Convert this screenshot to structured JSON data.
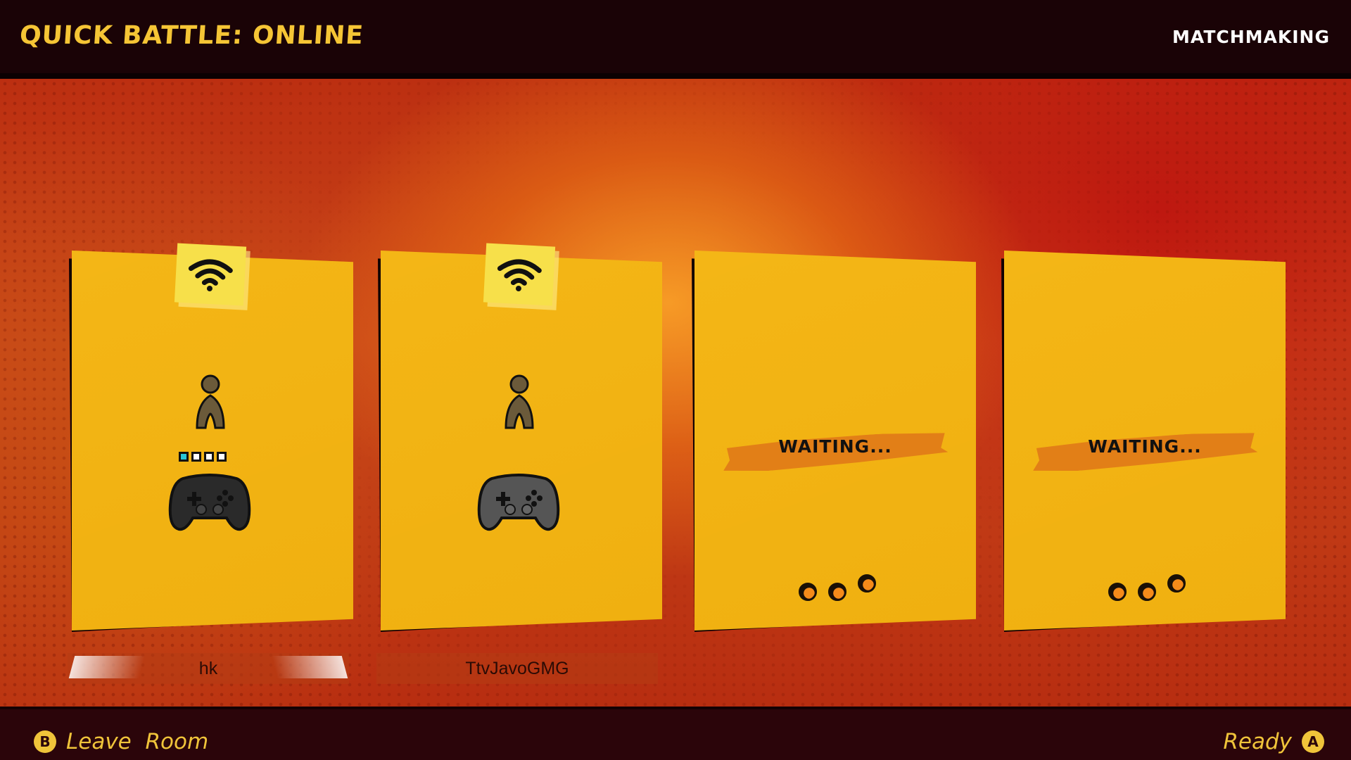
{
  "header": {
    "title": "QUICK BATTLE: ONLINE",
    "mode": "MATCHMAKING"
  },
  "slots": [
    {
      "state": "connected",
      "connection_icon": "wifi-icon",
      "player_icon": "player-icon",
      "controller_icon": "gamepad-icon",
      "player_name": "hk",
      "active_port": 1,
      "ports": 4
    },
    {
      "state": "connected",
      "connection_icon": "wifi-icon",
      "player_icon": "player-icon",
      "controller_icon": "gamepad-icon",
      "player_name": "TtvJavoGMG"
    },
    {
      "state": "waiting",
      "status_text": "WAITING...",
      "loading_icon": "loading-dots-icon"
    },
    {
      "state": "waiting",
      "status_text": "WAITING...",
      "loading_icon": "loading-dots-icon"
    }
  ],
  "footer": {
    "leave": {
      "button": "B",
      "label": "Leave  Room"
    },
    "ready": {
      "button": "A",
      "label": "Ready"
    }
  },
  "colors": {
    "card": "#f0b010",
    "accent_title": "#f5c535",
    "port_active": "#28c6d9",
    "waiting_brush": "#e27f17"
  }
}
